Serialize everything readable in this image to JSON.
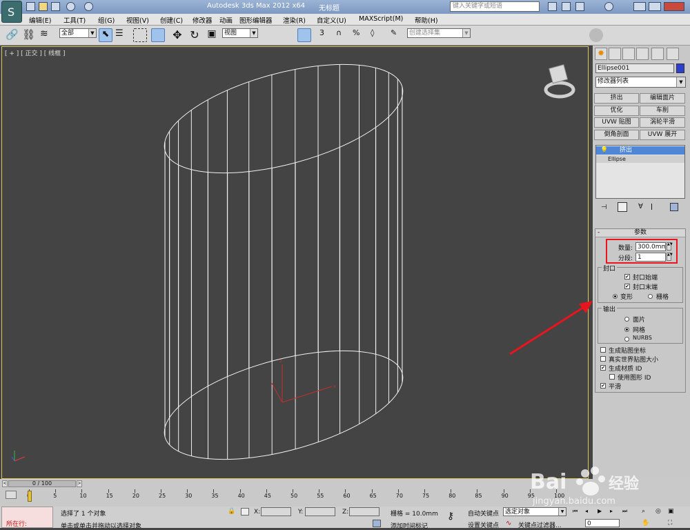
{
  "titlebar": {
    "app_title": "Autodesk 3ds Max  2012 x64",
    "doc_title": "无标题",
    "search_placeholder": "键入关键字或短语"
  },
  "menu": [
    "编辑(E)",
    "工具(T)",
    "组(G)",
    "视图(V)",
    "创建(C)",
    "修改器",
    "动画",
    "图形编辑器",
    "渲染(R)",
    "自定义(U)",
    "MAXScript(M)",
    "帮助(H)"
  ],
  "toolbar": {
    "selection_filter": "全部",
    "ref_coord": "视图",
    "named_selection": "创建选择集"
  },
  "viewport": {
    "label": "[ + ] [ 正交 ] [ 线框 ]",
    "axis_x": "x",
    "axis_z": "z"
  },
  "command_panel": {
    "object_name": "Ellipse001",
    "object_color": "#2d3fd0",
    "modifier_list": "修改器列表",
    "modifier_buttons": [
      "挤出",
      "编辑面片",
      "优化",
      "车削",
      "UVW 贴图",
      "涡轮平滑",
      "倒角剖面",
      "UVW 展开"
    ],
    "stack": [
      "挤出",
      "Ellipse"
    ],
    "rollout_title": "参数",
    "amount_label": "数量:",
    "amount_value": "300.0mm",
    "segments_label": "分段:",
    "segments_value": "1",
    "capping_title": "封口",
    "cap_start": "封口始端",
    "cap_end": "封口末端",
    "cap_morph": "变形",
    "cap_grid": "栅格",
    "output_title": "输出",
    "out_patch": "面片",
    "out_mesh": "网格",
    "out_nurbs": "NURBS",
    "gen_map_coords": "生成贴图坐标",
    "real_world_map": "真实世界贴图大小",
    "gen_mat_ids": "生成材质 ID",
    "use_shape_ids": "使用图形 ID",
    "smooth": "平滑"
  },
  "timeline": {
    "frame_counter": "0 / 100",
    "ticks": [
      "0",
      "5",
      "10",
      "15",
      "20",
      "25",
      "30",
      "35",
      "40",
      "45",
      "50",
      "55",
      "60",
      "65",
      "70",
      "75",
      "80",
      "85",
      "90",
      "95",
      "100"
    ]
  },
  "status": {
    "script_prompt": "所在行:",
    "selected": "选择了 1 个对象",
    "prompt": "单击或单击并拖动以选择对象",
    "x_label": "X:",
    "y_label": "Y:",
    "z_label": "Z:",
    "grid": "栅格 = 10.0mm",
    "add_time_tag": "添加时间标记",
    "auto_key": "自动关键点",
    "set_key": "设置关键点",
    "key_mode": "选定对象",
    "key_filters": "关键点过滤器...",
    "frame": "0"
  },
  "colors": {
    "annotation_red": "#e8141e",
    "selection_blue": "#4d7ec0"
  }
}
